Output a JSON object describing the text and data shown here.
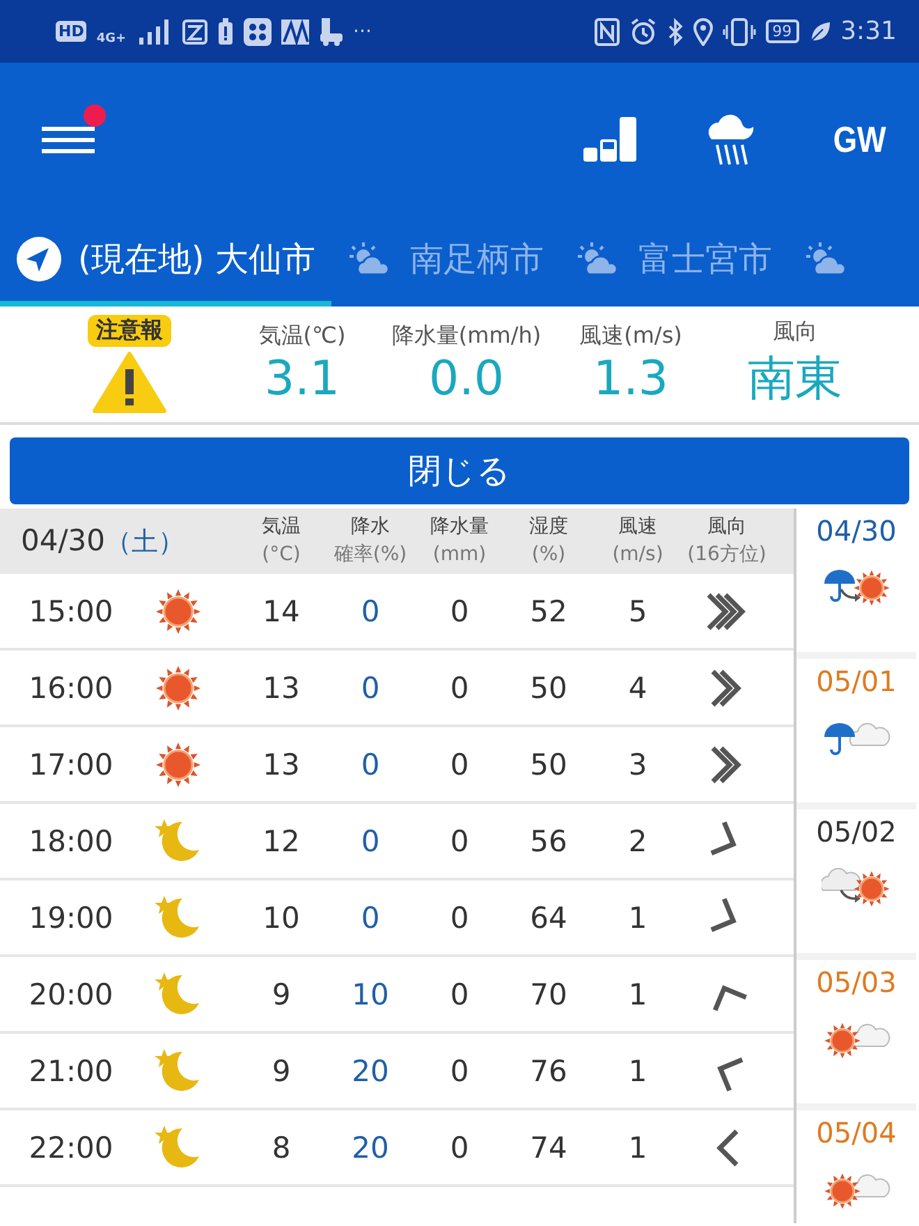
{
  "status_bar": {
    "hd": "HD",
    "network": "4G+",
    "more": "···",
    "battery": "99",
    "time": "3:31"
  },
  "header": {
    "menu_badge": true,
    "gw_button": "GW"
  },
  "tabs": [
    {
      "kind": "location",
      "label": "(現在地) 大仙市",
      "selected": true
    },
    {
      "kind": "weather",
      "label": "南足柄市",
      "selected": false
    },
    {
      "kind": "weather",
      "label": "富士宮市",
      "selected": false
    },
    {
      "kind": "weather",
      "selected": false
    }
  ],
  "warning": {
    "badge": "注意報"
  },
  "current": [
    {
      "label": "気温(℃)",
      "value": "3.1"
    },
    {
      "label": "降水量(mm/h)",
      "value": "0.0"
    },
    {
      "label": "風速(m/s)",
      "value": "1.3"
    },
    {
      "label": "風向",
      "value": "南東"
    }
  ],
  "close_button": "閉じる",
  "forecast": {
    "date": "04/30",
    "weekday": "（土）",
    "columns": [
      {
        "line1": "気温",
        "line2": "(°C)"
      },
      {
        "line1": "降水",
        "line2": "確率(%)"
      },
      {
        "line1": "降水量",
        "line2": "(mm)"
      },
      {
        "line1": "湿度",
        "line2": "(%)"
      },
      {
        "line1": "風速",
        "line2": "(m/s)"
      },
      {
        "line1": "風向",
        "line2": "(16方位)"
      }
    ],
    "rows": [
      {
        "time": "15:00",
        "kind": "sun",
        "temp": "14",
        "prob": "0",
        "amount": "0",
        "humidity": "52",
        "speed": "5",
        "wind": {
          "kind": "E_strong"
        }
      },
      {
        "time": "16:00",
        "kind": "sun",
        "temp": "13",
        "prob": "0",
        "amount": "0",
        "humidity": "50",
        "speed": "4",
        "wind": {
          "kind": "E_moderate"
        }
      },
      {
        "time": "17:00",
        "kind": "sun",
        "temp": "13",
        "prob": "0",
        "amount": "0",
        "humidity": "50",
        "speed": "3",
        "wind": {
          "kind": "E_moderate"
        }
      },
      {
        "time": "18:00",
        "kind": "moon",
        "temp": "12",
        "prob": "0",
        "amount": "0",
        "humidity": "56",
        "speed": "2",
        "wind": {
          "kind": "ESE_light"
        }
      },
      {
        "time": "19:00",
        "kind": "moon",
        "temp": "10",
        "prob": "0",
        "amount": "0",
        "humidity": "64",
        "speed": "1",
        "wind": {
          "kind": "ESE_light"
        }
      },
      {
        "time": "20:00",
        "kind": "moon",
        "temp": "9",
        "prob": "10",
        "amount": "0",
        "humidity": "70",
        "speed": "1",
        "wind": {
          "kind": "NNW_light"
        }
      },
      {
        "time": "21:00",
        "kind": "moon",
        "temp": "9",
        "prob": "20",
        "amount": "0",
        "humidity": "76",
        "speed": "1",
        "wind": {
          "kind": "WNW_light"
        }
      },
      {
        "time": "22:00",
        "kind": "moon",
        "temp": "8",
        "prob": "20",
        "amount": "0",
        "humidity": "74",
        "speed": "1",
        "wind": {
          "kind": "W_light"
        }
      }
    ]
  },
  "days": [
    {
      "date": "04/30",
      "color": "#1f5fa8",
      "kind": "rain_to_sun"
    },
    {
      "date": "05/01",
      "color": "#e07a20",
      "kind": "rain_cloud"
    },
    {
      "date": "05/02",
      "color": "#333333",
      "kind": "cloud_to_sun"
    },
    {
      "date": "05/03",
      "color": "#e07a20",
      "kind": "sun_cloud"
    },
    {
      "date": "05/04",
      "color": "#e07a20",
      "kind": "sun_cloud"
    }
  ]
}
